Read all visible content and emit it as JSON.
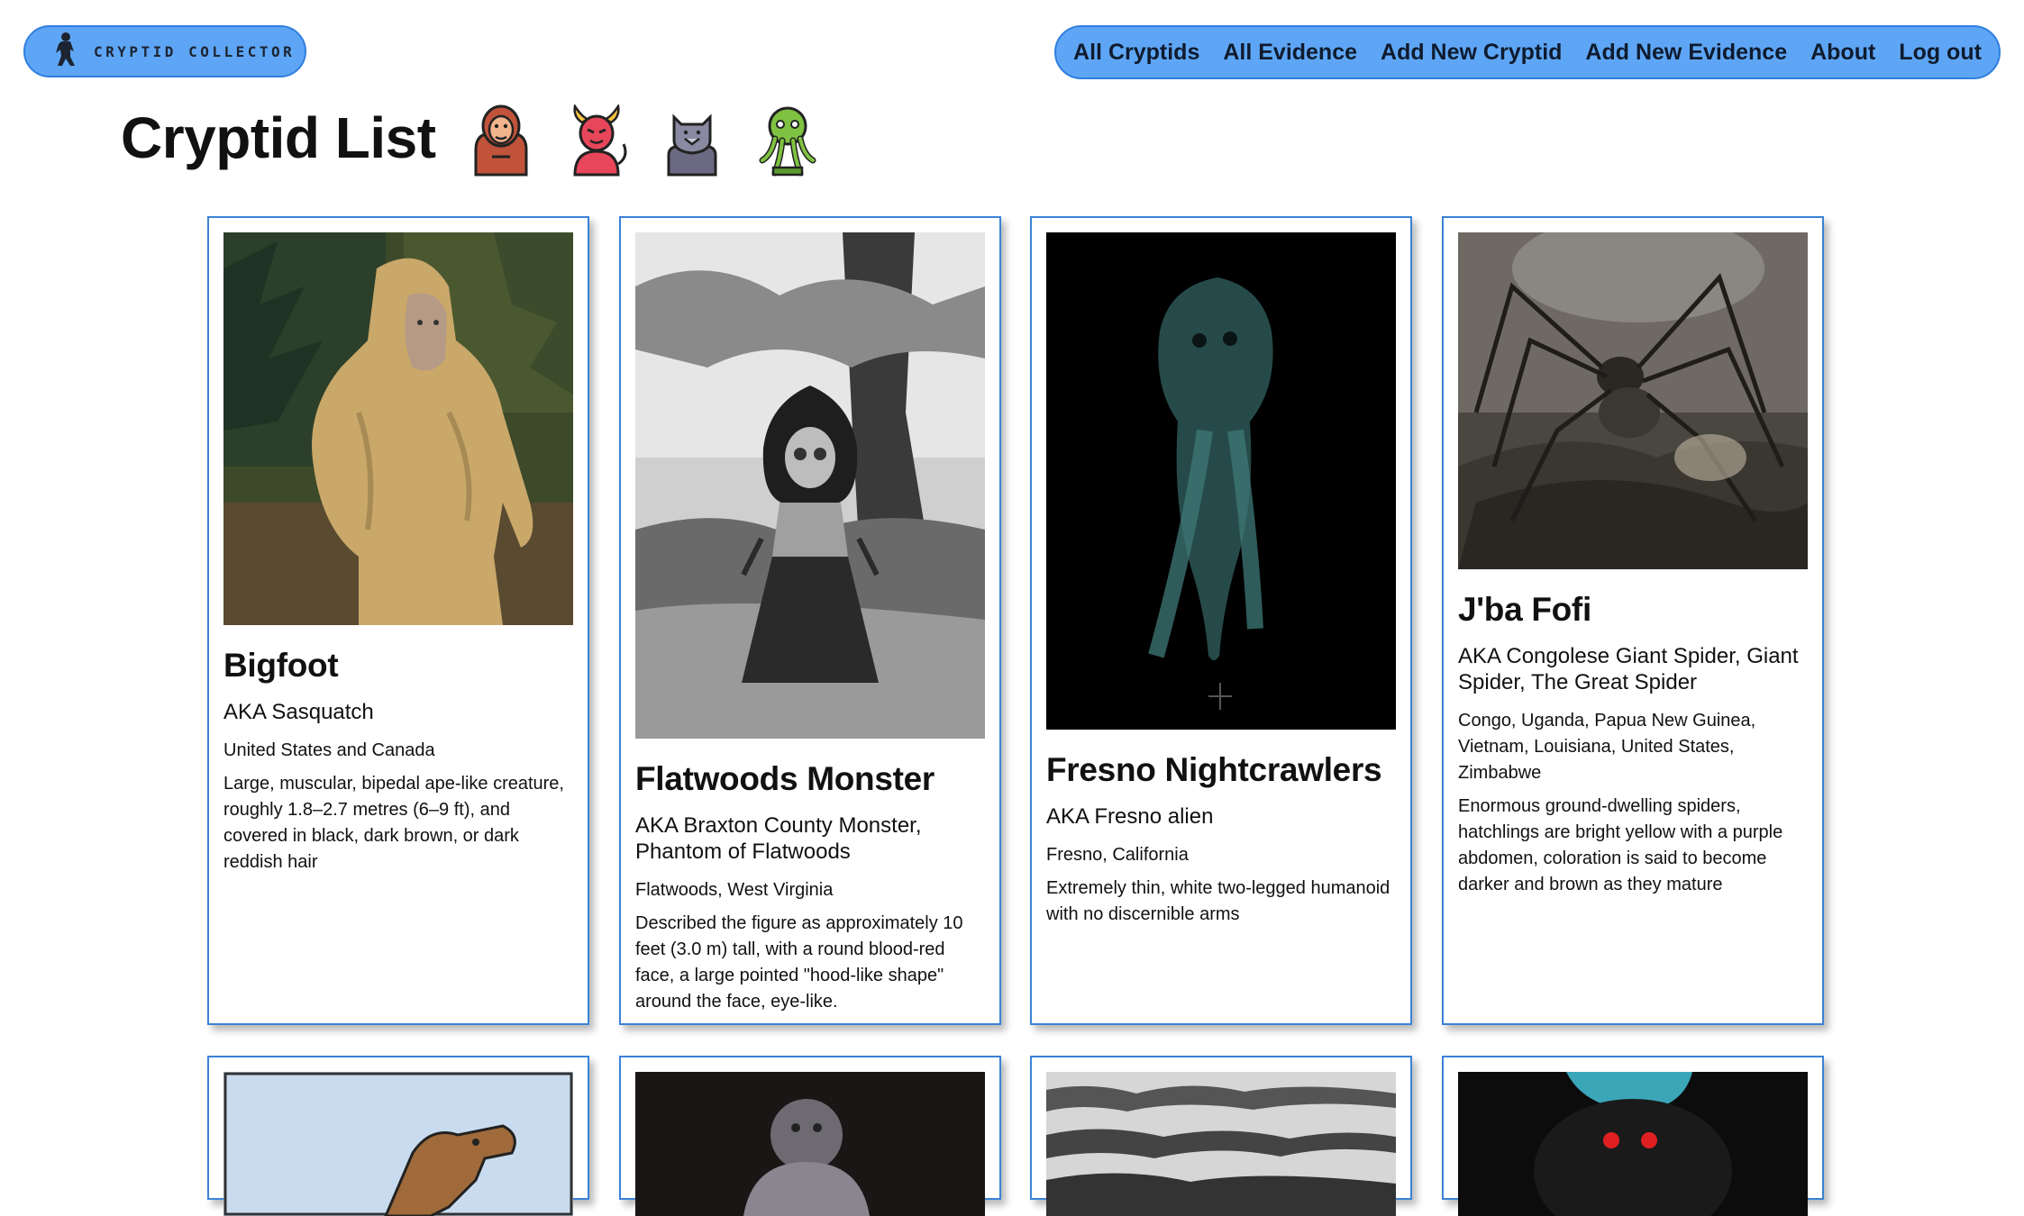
{
  "header": {
    "logo_text": "CRYPTID COLLECTOR",
    "logo_icon": "bigfoot-silhouette-icon",
    "nav": [
      "All Cryptids",
      "All Evidence",
      "Add New Cryptid",
      "Add New Evidence",
      "About",
      "Log out"
    ]
  },
  "page": {
    "title": "Cryptid List",
    "title_icons": [
      "bigfoot-face-icon",
      "devil-icon",
      "werewolf-icon",
      "cthulhu-icon"
    ]
  },
  "cryptids": [
    {
      "name": "Bigfoot",
      "aka": "AKA Sasquatch",
      "location": "United States and Canada",
      "description": "Large, muscular, bipedal ape-like creature, roughly 1.8–2.7 metres (6–9 ft), and covered in black, dark brown, or dark reddish hair"
    },
    {
      "name": "Flatwoods Monster",
      "aka": "AKA Braxton County Monster, Phantom of Flatwoods",
      "location": "Flatwoods, West Virginia",
      "description": "Described the figure as approximately 10 feet (3.0 m) tall, with a round blood-red face, a large pointed \"hood-like shape\" around the face, eye-like."
    },
    {
      "name": "Fresno Nightcrawlers",
      "aka": "AKA Fresno alien",
      "location": "Fresno, California",
      "description": "Extremely thin, white two-legged humanoid with no discernible arms"
    },
    {
      "name": "J'ba Fofi",
      "aka": "AKA Congolese Giant Spider, Giant Spider, The Great Spider",
      "location": "Congo, Uganda, Papua New Guinea, Vietnam, Louisiana, United States, Zimbabwe",
      "description": "Enormous ground-dwelling spiders, hatchlings are bright yellow with a purple abdomen, coloration is said to become darker and brown as they mature"
    }
  ],
  "colors": {
    "nav_bg": "#5ea6f5",
    "nav_border": "#2f7fe0",
    "card_border": "#3b82d6"
  }
}
